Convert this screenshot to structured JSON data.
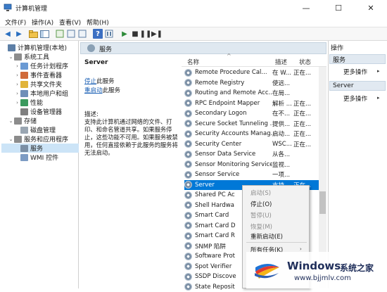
{
  "window": {
    "title": "计算机管理",
    "icons": {
      "app": "computer-management-icon",
      "minimize": "minimize-icon",
      "maximize": "maximize-icon",
      "close": "close-icon"
    }
  },
  "menu": [
    "文件(F)",
    "操作(A)",
    "查看(V)",
    "帮助(H)"
  ],
  "toolbar": [
    "back-arrow-icon",
    "forward-arrow-icon",
    "folder-up-icon",
    "console-tree-icon",
    "refresh-icon",
    "export-icon",
    "help-icon",
    "properties-icon",
    "play-icon",
    "stop-icon",
    "pause-icon",
    "restart-icon"
  ],
  "tree": [
    {
      "label": "计算机管理(本地)",
      "level": 0,
      "expander": "",
      "icon": "computer-icon"
    },
    {
      "label": "系统工具",
      "level": 1,
      "expander": "⌄",
      "icon": "tools-icon"
    },
    {
      "label": "任务计划程序",
      "level": 2,
      "expander": "›",
      "icon": "clock-icon"
    },
    {
      "label": "事件查看器",
      "level": 2,
      "expander": "›",
      "icon": "event-viewer-icon"
    },
    {
      "label": "共享文件夹",
      "level": 2,
      "expander": "›",
      "icon": "shared-folder-icon"
    },
    {
      "label": "本地用户和组",
      "level": 2,
      "expander": "›",
      "icon": "users-icon"
    },
    {
      "label": "性能",
      "level": 2,
      "expander": "›",
      "icon": "performance-icon"
    },
    {
      "label": "设备管理器",
      "level": 2,
      "expander": "",
      "icon": "device-manager-icon"
    },
    {
      "label": "存储",
      "level": 1,
      "expander": "⌄",
      "icon": "storage-icon"
    },
    {
      "label": "磁盘管理",
      "level": 2,
      "expander": "",
      "icon": "disk-icon"
    },
    {
      "label": "服务和应用程序",
      "level": 1,
      "expander": "⌄",
      "icon": "services-apps-icon"
    },
    {
      "label": "服务",
      "level": 2,
      "expander": "",
      "icon": "services-icon",
      "selected": true
    },
    {
      "label": "WMI 控件",
      "level": 2,
      "expander": "",
      "icon": "wmi-icon"
    }
  ],
  "center": {
    "header": "服务",
    "selected_name": "Server",
    "link_stop_link": "停止",
    "link_stop_rest": "此服务",
    "link_restart_link": "重启动",
    "link_restart_rest": "此服务",
    "desc_label": "描述:",
    "desc_lines": [
      "支持此计算机通过网络的文件、打",
      "印、和命名管道共享。如果服务停",
      "止，这些功能不可用。如果服务被禁",
      "用，任何直接依赖于此服务的服务将",
      "无法启动。"
    ]
  },
  "columns": {
    "name": "名称",
    "desc": "描述",
    "status": "状态"
  },
  "services": [
    {
      "name": "Remote Procedure Cal...",
      "desc": "在 W...",
      "status": "正在..."
    },
    {
      "name": "Remote Registry",
      "desc": "使远...",
      "status": ""
    },
    {
      "name": "Routing and Remote Acc...",
      "desc": "在局...",
      "status": ""
    },
    {
      "name": "RPC Endpoint Mapper",
      "desc": "解析 ...",
      "status": "正在..."
    },
    {
      "name": "Secondary Logon",
      "desc": "在不...",
      "status": "正在..."
    },
    {
      "name": "Secure Socket Tunneling ...",
      "desc": "提供...",
      "status": "正在..."
    },
    {
      "name": "Security Accounts Manag...",
      "desc": "启动...",
      "status": "正在..."
    },
    {
      "name": "Security Center",
      "desc": "WSC...",
      "status": "正在..."
    },
    {
      "name": "Sensor Data Service",
      "desc": "从各...",
      "status": ""
    },
    {
      "name": "Sensor Monitoring Service",
      "desc": "监视...",
      "status": ""
    },
    {
      "name": "Sensor Service",
      "desc": "一项...",
      "status": ""
    },
    {
      "name": "Server",
      "desc": "支持...",
      "status": "正在...",
      "selected": true
    },
    {
      "name": "Shared PC Ac",
      "desc": "",
      "status": ""
    },
    {
      "name": "Shell Hardwa",
      "desc": "",
      "status": ""
    },
    {
      "name": "Smart Card",
      "desc": "",
      "status": ""
    },
    {
      "name": "Smart Card D",
      "desc": "",
      "status": ""
    },
    {
      "name": "Smart Card R",
      "desc": "",
      "status": ""
    },
    {
      "name": "SNMP 陷阱",
      "desc": "",
      "status": ""
    },
    {
      "name": "Software Prot",
      "desc": "",
      "status": ""
    },
    {
      "name": "Spot Verifier",
      "desc": "",
      "status": ""
    },
    {
      "name": "SSDP Discove",
      "desc": "",
      "status": ""
    },
    {
      "name": "State Reposit",
      "desc": "",
      "status": ""
    }
  ],
  "context_menu": [
    {
      "label": "启动(S)",
      "disabled": true
    },
    {
      "label": "停止(O)",
      "disabled": false
    },
    {
      "label": "暂停(U)",
      "disabled": true
    },
    {
      "label": "恢复(M)",
      "disabled": true
    },
    {
      "label": "重新启动(E)",
      "disabled": false
    },
    {
      "label": "所有任务(K)",
      "disabled": false,
      "submenu": true
    }
  ],
  "actions": {
    "title": "操作",
    "sections": [
      {
        "header": "服务",
        "item": "更多操作"
      },
      {
        "header": "Server",
        "item": "更多操作"
      }
    ]
  },
  "watermark": {
    "brand": "Windows",
    "cn": "系统之家",
    "url": "www.bjjmlv.com"
  },
  "colors": {
    "selection": "#0078d7",
    "tree_selection": "#cce4f7",
    "header_bg": "#dfe8f0"
  }
}
